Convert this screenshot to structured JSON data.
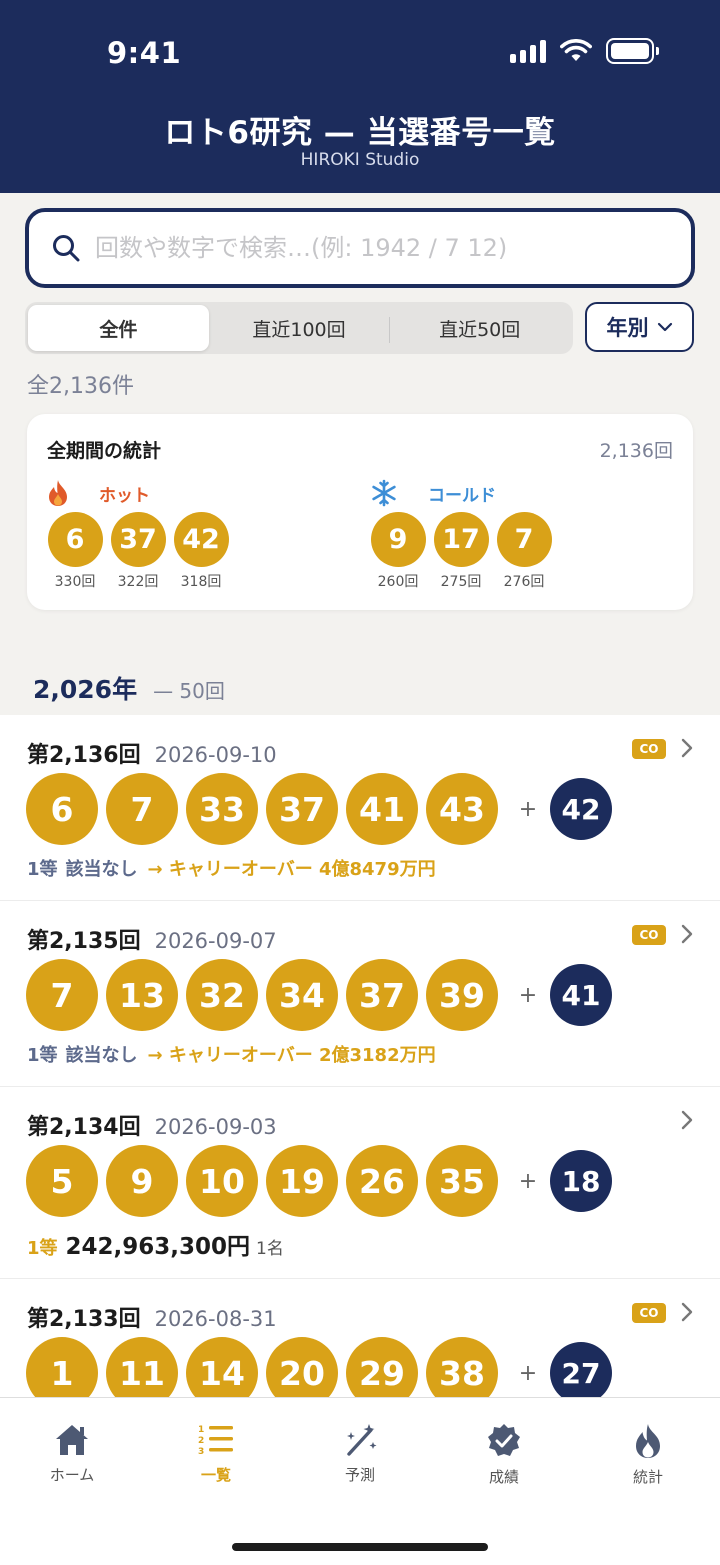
{
  "status_bar": {
    "time": "9:41"
  },
  "header": {
    "title": "ロト6研究 — 当選番号一覧",
    "subtitle": "HIROKI Studio"
  },
  "search": {
    "placeholder": "回数や数字で検索…(例: 1942 / 7 12)",
    "value": ""
  },
  "filter": {
    "segments": [
      {
        "label": "全件",
        "active": true
      },
      {
        "label": "直近100回",
        "active": false
      },
      {
        "label": "直近50回",
        "active": false
      }
    ],
    "year_button": "年別"
  },
  "total_count": "全2,136件",
  "stats": {
    "title": "全期間の統計",
    "draws": "2,136回",
    "hot": {
      "label": "ホット",
      "color": "#e05a2a",
      "items": [
        {
          "number": "6",
          "count": "330回"
        },
        {
          "number": "37",
          "count": "322回"
        },
        {
          "number": "42",
          "count": "318回"
        }
      ]
    },
    "cold": {
      "label": "コールド",
      "color": "#3d8ed6",
      "items": [
        {
          "number": "9",
          "count": "260回"
        },
        {
          "number": "17",
          "count": "275回"
        },
        {
          "number": "7",
          "count": "276回"
        }
      ]
    }
  },
  "year_section": {
    "year": "2,026年",
    "count": "— 50回"
  },
  "draws": [
    {
      "no": "第2,136回",
      "date": "2026-09-10",
      "carryover": true,
      "badge": "CO",
      "numbers": [
        "6",
        "7",
        "33",
        "37",
        "41",
        "43"
      ],
      "bonus": "42",
      "result": {
        "label": "1等",
        "none": "該当なし",
        "carryover": "→ キャリーオーバー 4億8479万円"
      }
    },
    {
      "no": "第2,135回",
      "date": "2026-09-07",
      "carryover": true,
      "badge": "CO",
      "numbers": [
        "7",
        "13",
        "32",
        "34",
        "37",
        "39"
      ],
      "bonus": "41",
      "result": {
        "label": "1等",
        "none": "該当なし",
        "carryover": "→ キャリーオーバー 2億3182万円"
      }
    },
    {
      "no": "第2,134回",
      "date": "2026-09-03",
      "carryover": false,
      "numbers": [
        "5",
        "9",
        "10",
        "19",
        "26",
        "35"
      ],
      "bonus": "18",
      "result": {
        "label": "1等",
        "amount": "242,963,300円",
        "winners": "1名"
      }
    },
    {
      "no": "第2,133回",
      "date": "2026-08-31",
      "carryover": true,
      "badge": "CO",
      "numbers": [
        "1",
        "11",
        "14",
        "20",
        "29",
        "38"
      ],
      "bonus": "27",
      "result": null
    }
  ],
  "tabs": [
    {
      "label": "ホーム",
      "icon": "home-icon",
      "active": false
    },
    {
      "label": "一覧",
      "icon": "list-icon",
      "active": true
    },
    {
      "label": "予測",
      "icon": "magic-wand-icon",
      "active": false
    },
    {
      "label": "成績",
      "icon": "badge-check-icon",
      "active": false
    },
    {
      "label": "統計",
      "icon": "flame-icon",
      "active": false
    }
  ],
  "colors": {
    "navy": "#1c2c5c",
    "gold": "#d9a218",
    "background": "#f3f2ef"
  }
}
